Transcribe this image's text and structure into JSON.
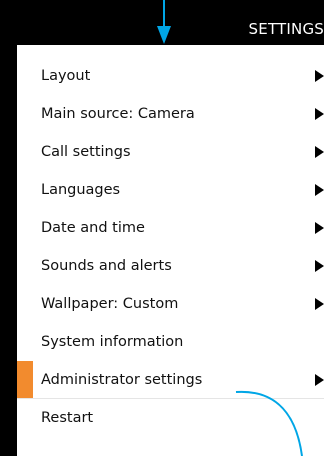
{
  "header": {
    "title": "SETTINGS"
  },
  "menu": {
    "items": [
      {
        "label": "Layout",
        "submenu": true,
        "selected": false
      },
      {
        "label": "Main source: Camera",
        "submenu": true,
        "selected": false
      },
      {
        "label": "Call settings",
        "submenu": true,
        "selected": false
      },
      {
        "label": "Languages",
        "submenu": true,
        "selected": false
      },
      {
        "label": "Date and time",
        "submenu": true,
        "selected": false
      },
      {
        "label": "Sounds and alerts",
        "submenu": true,
        "selected": false
      },
      {
        "label": "Wallpaper: Custom",
        "submenu": true,
        "selected": false
      },
      {
        "label": "System information",
        "submenu": false,
        "selected": false
      },
      {
        "label": "Administrator settings",
        "submenu": true,
        "selected": true
      },
      {
        "label": "Restart",
        "submenu": false,
        "selected": false
      }
    ]
  },
  "colors": {
    "accent": "#f28b2e",
    "callout": "#00a6e6",
    "header_bg": "#000000",
    "panel_bg": "#ffffff"
  }
}
